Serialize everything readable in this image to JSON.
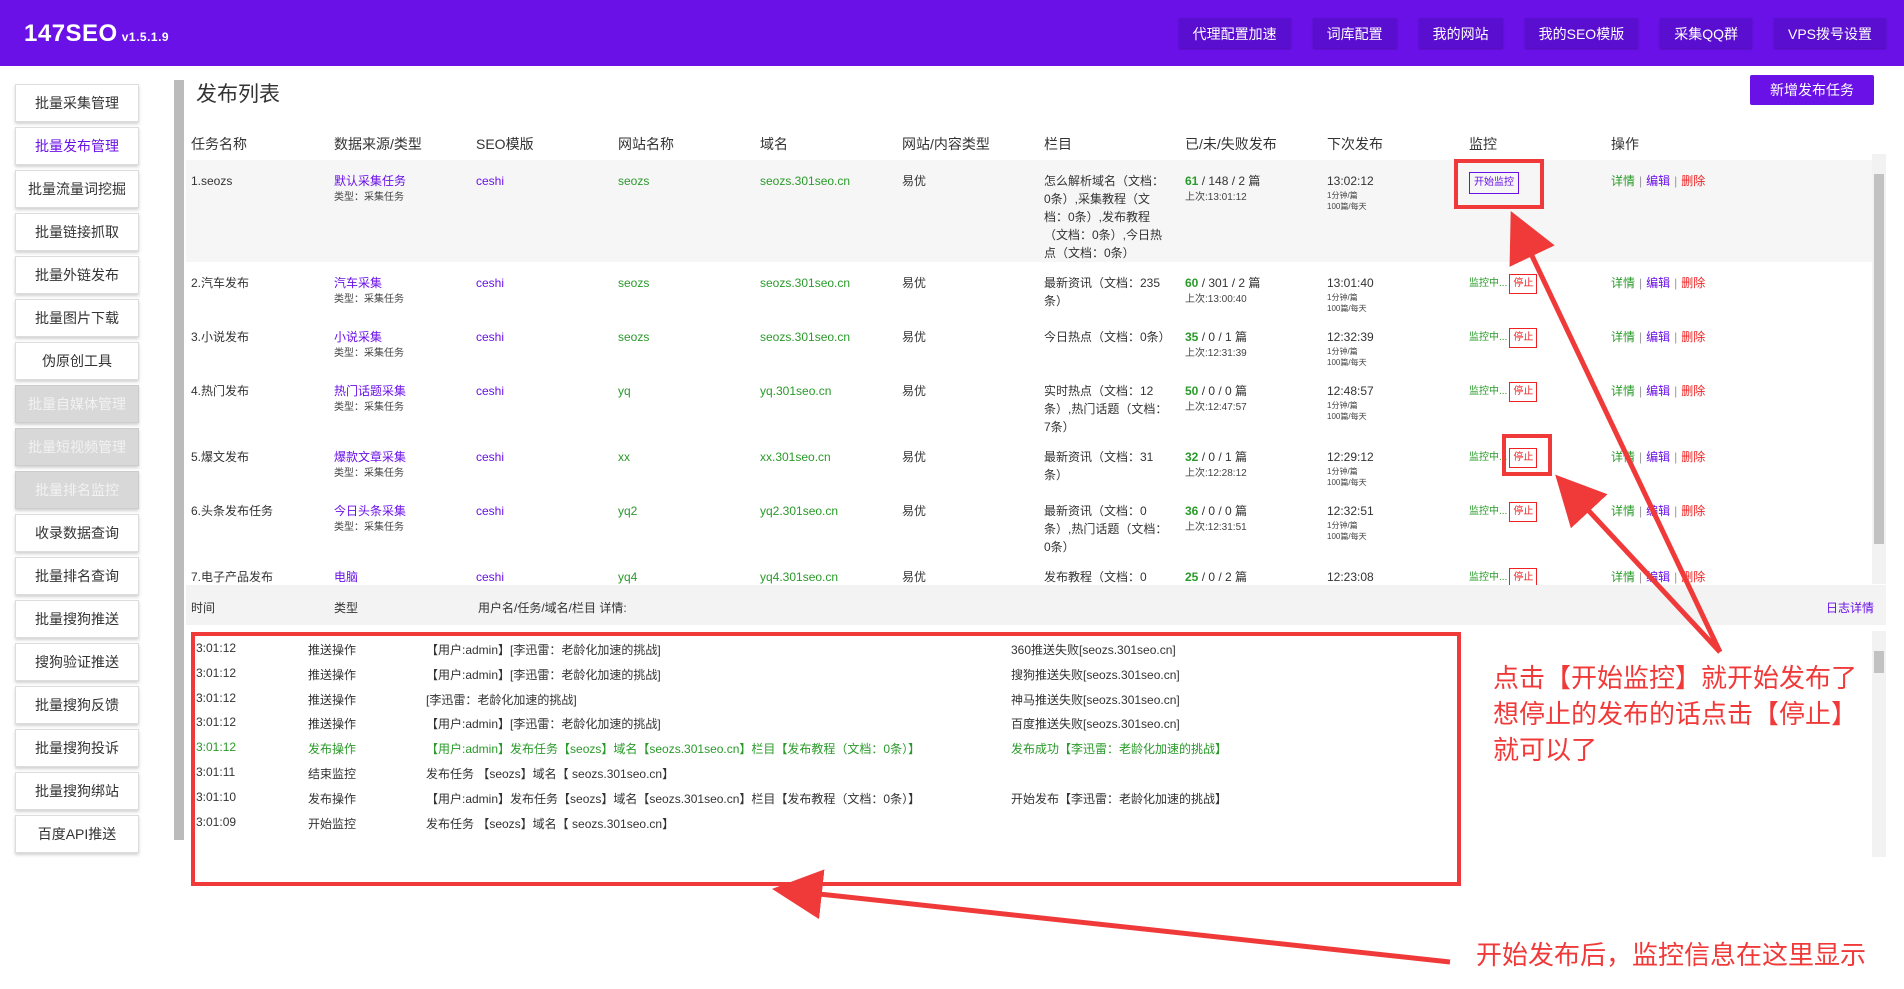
{
  "app": {
    "brand": "147SEO",
    "version": "v1.5.1.9"
  },
  "topnav": [
    "代理配置加速",
    "词库配置",
    "我的网站",
    "我的SEO模版",
    "采集QQ群",
    "VPS拨号设置"
  ],
  "sidebar": {
    "items": [
      {
        "label": "批量采集管理",
        "state": "normal"
      },
      {
        "label": "批量发布管理",
        "state": "active"
      },
      {
        "label": "批量流量词挖掘",
        "state": "normal"
      },
      {
        "label": "批量链接抓取",
        "state": "normal"
      },
      {
        "label": "批量外链发布",
        "state": "normal"
      },
      {
        "label": "批量图片下载",
        "state": "normal"
      },
      {
        "label": "伪原创工具",
        "state": "normal"
      },
      {
        "label": "批量自媒体管理",
        "state": "disabled"
      },
      {
        "label": "批量短视频管理",
        "state": "disabled"
      },
      {
        "label": "批量排名监控",
        "state": "disabled"
      },
      {
        "label": "收录数据查询",
        "state": "normal"
      },
      {
        "label": "批量排名查询",
        "state": "normal"
      },
      {
        "label": "批量搜狗推送",
        "state": "normal"
      },
      {
        "label": "搜狗验证推送",
        "state": "normal"
      },
      {
        "label": "批量搜狗反馈",
        "state": "normal"
      },
      {
        "label": "批量搜狗投诉",
        "state": "normal"
      },
      {
        "label": "批量搜狗绑站",
        "state": "normal"
      },
      {
        "label": "百度API推送",
        "state": "normal"
      }
    ]
  },
  "main": {
    "title": "发布列表",
    "add_button": "新增发布任务"
  },
  "table": {
    "headers": [
      "任务名称",
      "数据来源/类型",
      "SEO模版",
      "网站名称",
      "域名",
      "网站/内容类型",
      "栏目",
      "已/未/失败发布",
      "下次发布",
      "监控",
      "操作"
    ],
    "type_label": "类型：采集任务",
    "mon_start": "开始监控",
    "mon_running": "监控中...",
    "mon_stop": "停止",
    "ops": {
      "detail": "详情",
      "edit": "编辑",
      "delete": "删除"
    },
    "freq1": "1分钟/篇",
    "freq2": "100篇/每天",
    "rows": [
      {
        "name": "1.seozs",
        "source": "默认采集任务",
        "seo": "ceshi",
        "site": "seozs",
        "domain": "seozs.301seo.cn",
        "ctype": "易优",
        "column": "怎么解析域名（文档：0条）,采集教程（文档：0条）,发布教程（文档：0条）,今日热点（文档：0条）",
        "done": "61",
        "rest": " / 148 / 2 篇",
        "last": "上次:13:01:12",
        "next": "13:02:12",
        "monitor": "start"
      },
      {
        "name": "2.汽车发布",
        "source": "汽车采集",
        "seo": "ceshi",
        "site": "seozs",
        "domain": "seozs.301seo.cn",
        "ctype": "易优",
        "column": "最新资讯（文档：235条）",
        "done": "60",
        "rest": " / 301 / 2 篇",
        "last": "上次:13:00:40",
        "next": "13:01:40",
        "monitor": "running"
      },
      {
        "name": "3.小说发布",
        "source": "小说采集",
        "seo": "ceshi",
        "site": "seozs",
        "domain": "seozs.301seo.cn",
        "ctype": "易优",
        "column": "今日热点（文档：0条）",
        "done": "35",
        "rest": " / 0 / 1 篇",
        "last": "上次:12:31:39",
        "next": "12:32:39",
        "monitor": "running"
      },
      {
        "name": "4.热门发布",
        "source": "热门话题采集",
        "seo": "ceshi",
        "site": "yq",
        "domain": "yq.301seo.cn",
        "ctype": "易优",
        "column": "实时热点（文档：12条）,热门话题（文档：7条）",
        "done": "50",
        "rest": " / 0 / 0 篇",
        "last": "上次:12:47:57",
        "next": "12:48:57",
        "monitor": "running"
      },
      {
        "name": "5.爆文发布",
        "source": "爆款文章采集",
        "seo": "ceshi",
        "site": "xx",
        "domain": "xx.301seo.cn",
        "ctype": "易优",
        "column": "最新资讯（文档：31条）",
        "done": "32",
        "rest": " / 0 / 1 篇",
        "last": "上次:12:28:12",
        "next": "12:29:12",
        "monitor": "running"
      },
      {
        "name": "6.头条发布任务",
        "source": "今日头条采集",
        "seo": "ceshi",
        "site": "yq2",
        "domain": "yq2.301seo.cn",
        "ctype": "易优",
        "column": "最新资讯（文档：0条）,热门话题（文档：0条）",
        "done": "36",
        "rest": " / 0 / 0 篇",
        "last": "上次:12:31:51",
        "next": "12:32:51",
        "monitor": "running"
      },
      {
        "name": "7.电子产品发布",
        "source": "电脑",
        "seo": "ceshi",
        "site": "yq4",
        "domain": "yq4.301seo.cn",
        "ctype": "易优",
        "column": "发布教程（文档：0",
        "done": "25",
        "rest": " / 0 / 2 篇",
        "last": "",
        "next": "12:23:08",
        "monitor": "running"
      }
    ]
  },
  "log": {
    "headers": {
      "time": "时间",
      "type": "类型",
      "detail": "用户名/任务/域名/栏目 详情:",
      "link": "日志详情"
    },
    "rows": [
      {
        "time": "3:01:12",
        "type": "推送操作",
        "detail": "【用户:admin】[李迅雷：老龄化加速的挑战]",
        "result": "360推送失败[seozs.301seo.cn]",
        "green": false
      },
      {
        "time": "3:01:12",
        "type": "推送操作",
        "detail": "【用户:admin】[李迅雷：老龄化加速的挑战]",
        "result": "搜狗推送失败[seozs.301seo.cn]",
        "green": false
      },
      {
        "time": "3:01:12",
        "type": "推送操作",
        "detail": "[李迅雷：老龄化加速的挑战]",
        "result": "神马推送失败[seozs.301seo.cn]",
        "green": false
      },
      {
        "time": "3:01:12",
        "type": "推送操作",
        "detail": "【用户:admin】[李迅雷：老龄化加速的挑战]",
        "result": "百度推送失败[seozs.301seo.cn]",
        "green": false
      },
      {
        "time": "3:01:12",
        "type": "发布操作",
        "detail": "【用户:admin】发布任务【seozs】域名【seozs.301seo.cn】栏目【发布教程（文档：0条）】",
        "result": "发布成功【李迅雷：老龄化加速的挑战】",
        "green": true
      },
      {
        "time": "3:01:11",
        "type": "结束监控",
        "detail": "发布任务 【seozs】域名【 seozs.301seo.cn】",
        "result": "",
        "green": false
      },
      {
        "time": "3:01:10",
        "type": "发布操作",
        "detail": "【用户:admin】发布任务【seozs】域名【seozs.301seo.cn】栏目【发布教程（文档：0条）】",
        "result": "开始发布【李迅雷：老龄化加速的挑战】",
        "green": false
      },
      {
        "time": "3:01:09",
        "type": "开始监控",
        "detail": "发布任务 【seozs】域名【 seozs.301seo.cn】",
        "result": "",
        "green": false
      }
    ]
  },
  "annotations": {
    "line1": "点击【开始监控】就开始发布了",
    "line2": "想停止的发布的话点击【停止】",
    "line3": "就可以了",
    "bottom": "开始发布后，监控信息在这里显示"
  },
  "colors": {
    "brand": "#6a11e8",
    "green": "#2a9a2a",
    "red": "#e22222",
    "annotation": "#f03a3a"
  }
}
